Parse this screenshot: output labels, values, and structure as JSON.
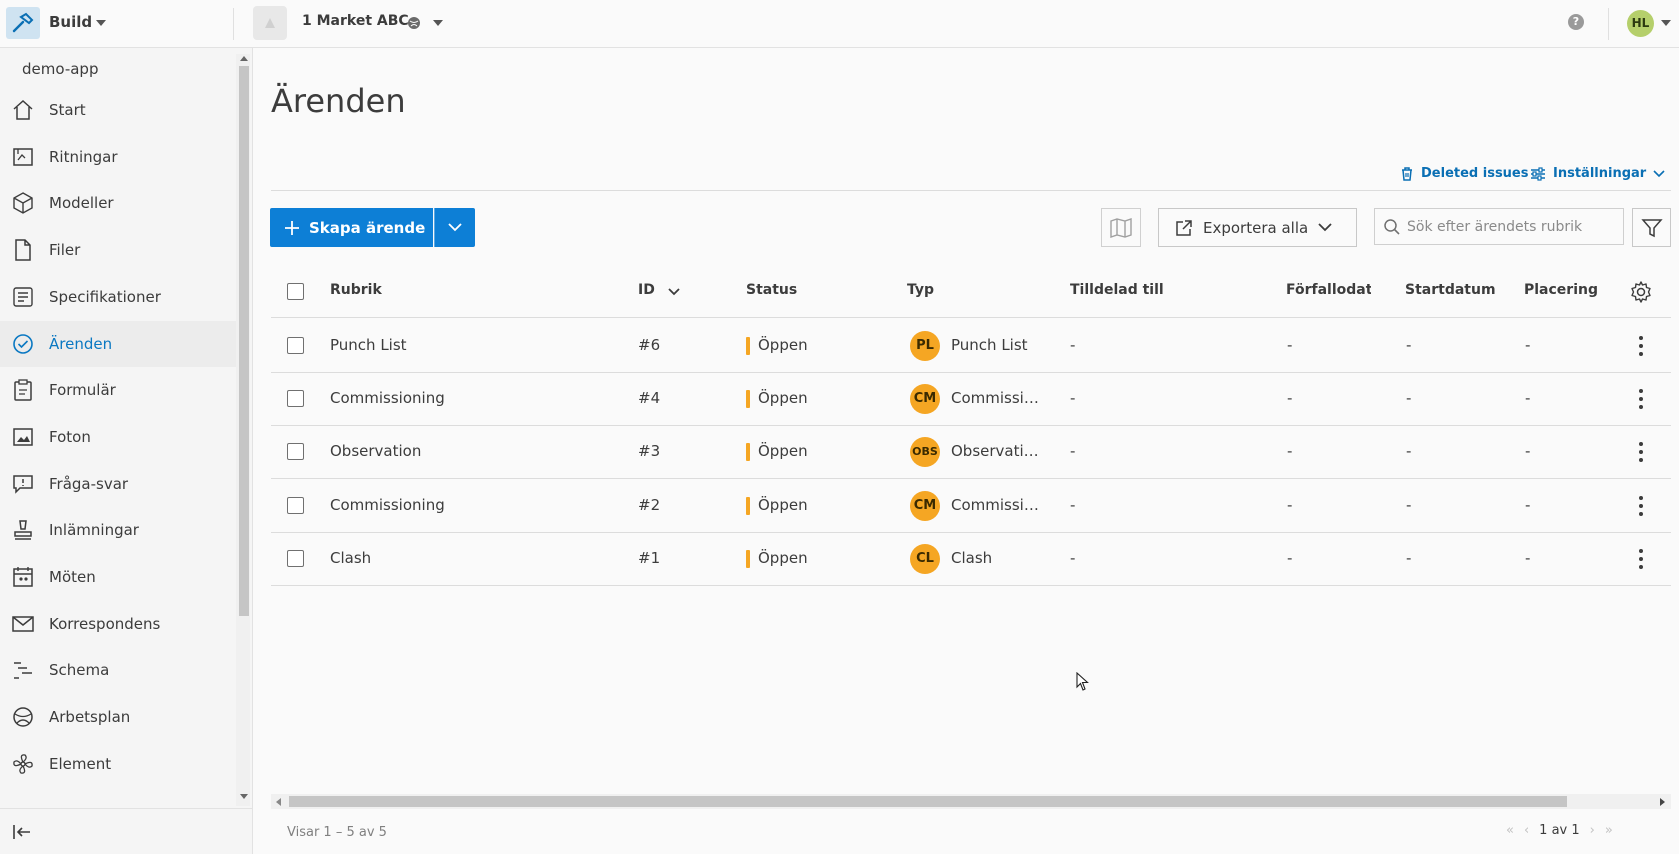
{
  "topbar": {
    "product": "Build",
    "project": "1 Market ABC",
    "help": "?",
    "user_initials": "HL"
  },
  "sidebar": {
    "app_name": "demo-app",
    "items": [
      {
        "label": "Start",
        "icon": "home-icon",
        "active": false
      },
      {
        "label": "Ritningar",
        "icon": "sheets-icon",
        "active": false
      },
      {
        "label": "Modeller",
        "icon": "cube-icon",
        "active": false
      },
      {
        "label": "Filer",
        "icon": "file-icon",
        "active": false
      },
      {
        "label": "Specifikationer",
        "icon": "spec-list-icon",
        "active": false
      },
      {
        "label": "Ärenden",
        "icon": "check-circle-icon",
        "active": true
      },
      {
        "label": "Formulär",
        "icon": "clipboard-icon",
        "active": false
      },
      {
        "label": "Foton",
        "icon": "photo-icon",
        "active": false
      },
      {
        "label": "Fråga-svar",
        "icon": "speech-bubble-icon",
        "active": false
      },
      {
        "label": "Inlämningar",
        "icon": "stamp-icon",
        "active": false
      },
      {
        "label": "Möten",
        "icon": "calendar-people-icon",
        "active": false
      },
      {
        "label": "Korrespondens",
        "icon": "mail-icon",
        "active": false
      },
      {
        "label": "Schema",
        "icon": "schedule-icon",
        "active": false
      },
      {
        "label": "Arbetsplan",
        "icon": "worldplan-icon",
        "active": false
      },
      {
        "label": "Element",
        "icon": "fan-icon",
        "active": false
      }
    ]
  },
  "main": {
    "title": "Ärenden",
    "deleted_issues": "Deleted issues",
    "settings": "Inställningar",
    "create_button": "Skapa ärende",
    "export_button": "Exportera alla",
    "search_placeholder": "Sök efter ärendets rubrik"
  },
  "table": {
    "columns": {
      "rubrik": "Rubrik",
      "id": "ID",
      "status": "Status",
      "typ": "Typ",
      "tilldelad": "Tilldelad till",
      "forfallo": "Förfallodatum",
      "start": "Startdatum",
      "placering": "Placering"
    },
    "rows": [
      {
        "rubrik": "Punch List",
        "id": "#6",
        "status": "Öppen",
        "badge": "PL",
        "typ": "Punch List",
        "tilldelad": "-",
        "forfallo": "-",
        "start": "-",
        "placering": "-"
      },
      {
        "rubrik": "Commissioning",
        "id": "#4",
        "status": "Öppen",
        "badge": "CM",
        "typ": "Commissi…",
        "tilldelad": "-",
        "forfallo": "-",
        "start": "-",
        "placering": "-"
      },
      {
        "rubrik": "Observation",
        "id": "#3",
        "status": "Öppen",
        "badge": "OBS",
        "typ": "Observati…",
        "tilldelad": "-",
        "forfallo": "-",
        "start": "-",
        "placering": "-"
      },
      {
        "rubrik": "Commissioning",
        "id": "#2",
        "status": "Öppen",
        "badge": "CM",
        "typ": "Commissi…",
        "tilldelad": "-",
        "forfallo": "-",
        "start": "-",
        "placering": "-"
      },
      {
        "rubrik": "Clash",
        "id": "#1",
        "status": "Öppen",
        "badge": "CL",
        "typ": "Clash",
        "tilldelad": "-",
        "forfallo": "-",
        "start": "-",
        "placering": "-"
      }
    ]
  },
  "footer": {
    "count": "Visar 1 – 5 av 5",
    "page": "1 av 1"
  },
  "colors": {
    "accent": "#0d7fd6",
    "status_open": "#f5a623",
    "active_nav": "#0a78c2"
  }
}
